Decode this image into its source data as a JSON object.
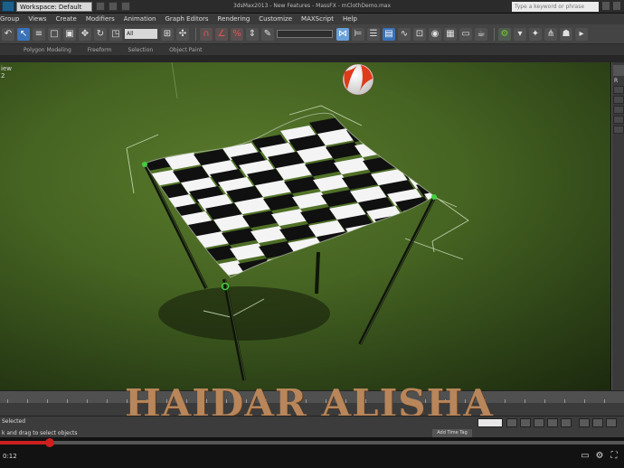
{
  "titlebar": {
    "workspace": "Workspace: Default",
    "title": "3dsMax2013 - New Features - MassFX - mClothDemo.max",
    "search_placeholder": "Type a keyword or phrase"
  },
  "menu": [
    "Group",
    "Views",
    "Create",
    "Modifiers",
    "Animation",
    "Graph Editors",
    "Rendering",
    "Customize",
    "MAXScript",
    "Help"
  ],
  "toolbar": {
    "selection_filter": "All",
    "accent": "#3a72b8"
  },
  "ribbon": {
    "tabs": [
      "Polygon Modeling",
      "Freeform",
      "Selection",
      "Object Paint"
    ]
  },
  "viewport": {
    "label": "iew 2",
    "background": "#466422",
    "cloth_pattern": "checkerboard"
  },
  "command_panel": {
    "label": "R"
  },
  "watermark": "HAIDAR ALISHA",
  "status": {
    "selection": "Selected",
    "prompt": "k and drag to select objects",
    "add_time_tag": "Add Time Tag"
  },
  "player": {
    "time": "0:12",
    "progress_fraction": 0.08,
    "accent": "#cc1f1f"
  }
}
